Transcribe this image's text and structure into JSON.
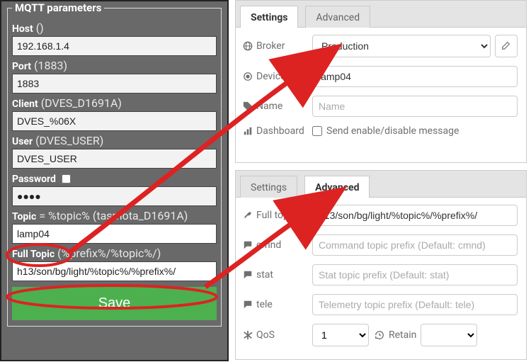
{
  "left": {
    "legend": "MQTT parameters",
    "host": {
      "label": "Host",
      "hint": "()",
      "value": "192.168.1.4"
    },
    "port": {
      "label": "Port",
      "hint": "(1883)",
      "value": "1883"
    },
    "client": {
      "label": "Client",
      "hint": "(DVES_D1691A)",
      "value": "DVES_%06X"
    },
    "user": {
      "label": "User",
      "hint": "(DVES_USER)",
      "value": "DVES_USER"
    },
    "password": {
      "label": "Password",
      "value": "●●●●"
    },
    "topic": {
      "label": "Topic",
      "hint": "= %topic% (tasmota_D1691A)",
      "value": "lamp04"
    },
    "fulltopic": {
      "label": "Full Topic",
      "hint": "(%prefix%/%topic%/)",
      "value": "h13/son/bg/light/%topic%/%prefix%/"
    },
    "save": "Save"
  },
  "cardA": {
    "tabs": {
      "settings": "Settings",
      "advanced": "Advanced"
    },
    "broker": {
      "label": "Broker",
      "value": "Production"
    },
    "device": {
      "label": "Device",
      "value": "lamp04"
    },
    "name": {
      "label": "Name",
      "placeholder": "Name"
    },
    "dash": {
      "label": "Dashboard",
      "check_label": "Send enable/disable message"
    }
  },
  "cardB": {
    "tabs": {
      "settings": "Settings",
      "advanced": "Advanced"
    },
    "fulltopic": {
      "label": "Full topic",
      "value": "h13/son/bg/light/%topic%/%prefix%/"
    },
    "cmnd": {
      "label": "cmnd",
      "placeholder": "Command topic prefix (Default: cmnd)"
    },
    "stat": {
      "label": "stat",
      "placeholder": "Stat topic prefix (Default: stat)"
    },
    "tele": {
      "label": "tele",
      "placeholder": "Telemetry topic prefix (Default: tele)"
    },
    "qos": {
      "label": "QoS",
      "value": "1"
    },
    "retain": {
      "label": "Retain",
      "value": ""
    }
  }
}
